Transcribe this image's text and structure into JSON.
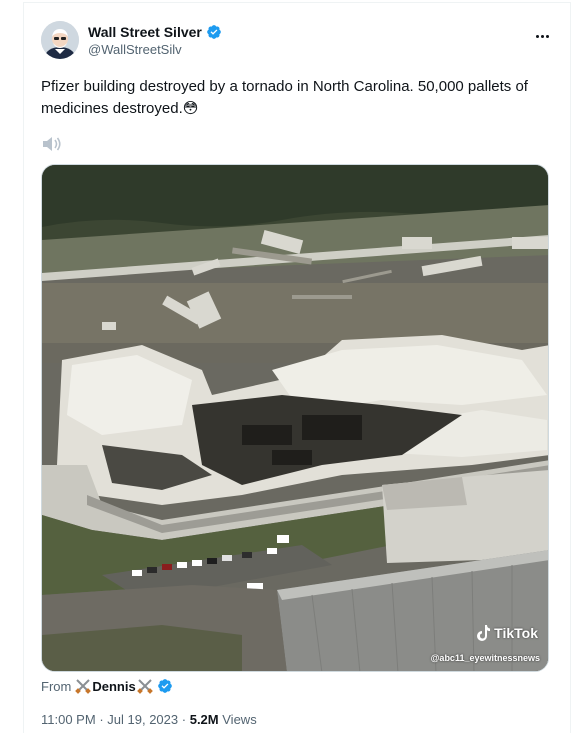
{
  "tweet": {
    "author_name": "Wall Street Silver",
    "author_handle": "@WallStreetSilv",
    "text": "Pfizer building destroyed by a tornado in North Carolina. 50,000 pallets of medicines destroyed.",
    "emoji": "😳",
    "media": {
      "watermark_brand": "TikTok",
      "watermark_handle": "@abc11_eyewitnessnews"
    },
    "from_label": "From",
    "from_user": "Dennis",
    "time": "11:00 PM",
    "separator": "·",
    "date": "Jul 19, 2023",
    "views_count": "5.2M",
    "views_label": "Views"
  },
  "colors": {
    "verified": "#1d9bf0",
    "secondary_text": "#536471",
    "primary_text": "#0f1419"
  },
  "icons": [
    "verified-badge-icon",
    "more-options-icon",
    "speaker-icon",
    "swords-icon",
    "tiktok-logo-icon"
  ]
}
